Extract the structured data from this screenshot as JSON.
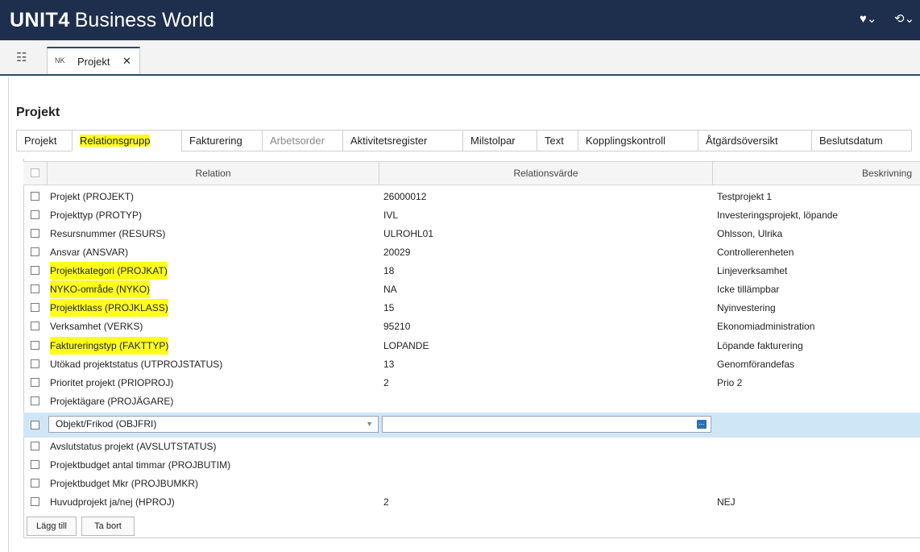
{
  "app": {
    "brand_logo": "UNIT4",
    "brand_name": "Business World",
    "heart_icon": "♥⌄",
    "history_icon": "⟲⌄"
  },
  "tabstrip": {
    "open_tab_prefix": "NK",
    "open_tab_label": "Projekt",
    "close_glyph": "✕"
  },
  "page": {
    "title": "Projekt"
  },
  "tabs": [
    {
      "label": "Projekt"
    },
    {
      "label": "Relationsgrupp",
      "active": true,
      "highlighted": true
    },
    {
      "label": "Fakturering"
    },
    {
      "label": "Arbetsorder",
      "disabled": true
    },
    {
      "label": "Aktivitetsregister"
    },
    {
      "label": "Milstolpar"
    },
    {
      "label": "Text"
    },
    {
      "label": "Kopplingskontroll"
    },
    {
      "label": "Åtgärdsöversikt"
    },
    {
      "label": "Beslutsdatum"
    }
  ],
  "grid": {
    "columns": [
      "Relation",
      "Relationsvärde",
      "Beskrivning"
    ],
    "rows": [
      {
        "relation": "Projekt (PROJEKT)",
        "value": "26000012",
        "description": "Testprojekt 1"
      },
      {
        "relation": "Projekttyp (PROTYP)",
        "value": "IVL",
        "description": "Investeringsprojekt, löpande"
      },
      {
        "relation": "Resursnummer (RESURS)",
        "value": "ULROHL01",
        "description": "Ohlsson, Ulrika"
      },
      {
        "relation": "Ansvar (ANSVAR)",
        "value": "20029",
        "description": "Controllerenheten"
      },
      {
        "relation": "Projektkategori (PROJKAT)",
        "value": "18",
        "description": "Linjeverksamhet",
        "highlighted": true
      },
      {
        "relation": "NYKO-område (NYKO)",
        "value": "NA",
        "description": "Icke tillämpbar",
        "highlighted": true
      },
      {
        "relation": "Projektklass (PROJKLASS)",
        "value": "15",
        "description": "Nyinvestering",
        "highlighted": true
      },
      {
        "relation": "Verksamhet (VERKS)",
        "value": "95210",
        "description": "Ekonomiadministration"
      },
      {
        "relation": "Faktureringstyp (FAKTTYP)",
        "value": "LOPANDE",
        "description": "Löpande fakturering",
        "highlighted": true
      },
      {
        "relation": "Utökad projektstatus (UTPROJSTATUS)",
        "value": "13",
        "description": "Genomförandefas"
      },
      {
        "relation": "Prioritet projekt (PRIOPROJ)",
        "value": "2",
        "description": "Prio 2"
      },
      {
        "relation": "Projektägare (PROJÄGARE)",
        "value": "",
        "description": ""
      }
    ],
    "edit_row": {
      "relation": "Objekt/Frikod (OBJFRI)",
      "value": ""
    },
    "rows_after": [
      {
        "relation": "Avslutstatus projekt (AVSLUTSTATUS)",
        "value": "",
        "description": ""
      },
      {
        "relation": "Projektbudget antal timmar (PROJBUTIM)",
        "value": "",
        "description": ""
      },
      {
        "relation": "Projektbudget Mkr (PROJBUMKR)",
        "value": "",
        "description": ""
      },
      {
        "relation": "Huvudprojekt ja/nej (HPROJ)",
        "value": "2",
        "description": "NEJ"
      }
    ]
  },
  "buttons": {
    "add": "Lägg till",
    "remove": "Ta bort"
  },
  "colors": {
    "topbar": "#1d2f4d",
    "highlight": "#ffff19",
    "selected_row": "#cfe6f7"
  }
}
